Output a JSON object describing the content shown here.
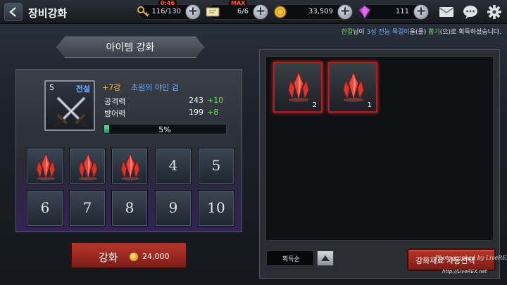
{
  "header": {
    "title": "장비강화",
    "back_icon": "back-arrow-icon"
  },
  "resources": {
    "key": {
      "icon": "key-icon",
      "value": "116/130",
      "timer": "0:46"
    },
    "ticket": {
      "icon": "ticket-icon",
      "value": "6/6",
      "badge": "MAX"
    },
    "gold": {
      "icon": "gold-coin-icon",
      "value": "33,509"
    },
    "gem": {
      "icon": "purple-gem-icon",
      "value": "111"
    }
  },
  "top_icons": [
    "mail-icon",
    "chat-icon",
    "settings-gear-icon"
  ],
  "notice": {
    "player": "한칼",
    "part1": "님이 ",
    "item": "3성 전능 목걸이",
    "part2": "을(를) ",
    "source": "뽑기",
    "part3": "(으)로 획득하셨습니다."
  },
  "enhance_panel": {
    "title": "아이템 강화",
    "item": {
      "slot_level": "5",
      "grade": "전설",
      "icon": "crossed-swords-icon",
      "enhance_level": "+7강",
      "name": "초원의 야인 검"
    },
    "stats": [
      {
        "label": "공격력",
        "value": "243",
        "bonus": "+10"
      },
      {
        "label": "방어력",
        "value": "199",
        "bonus": "+8"
      }
    ],
    "progress": {
      "percent": 5,
      "label": "5%"
    },
    "slots": [
      {
        "type": "crystal",
        "label": ""
      },
      {
        "type": "crystal",
        "label": ""
      },
      {
        "type": "crystal",
        "label": ""
      },
      {
        "type": "empty",
        "label": "4"
      },
      {
        "type": "empty",
        "label": "5"
      },
      {
        "type": "empty",
        "label": "6"
      },
      {
        "type": "empty",
        "label": "7"
      },
      {
        "type": "empty",
        "label": "8"
      },
      {
        "type": "empty",
        "label": "9"
      },
      {
        "type": "empty",
        "label": "10"
      }
    ],
    "enhance_button": {
      "label": "강화",
      "cost": "24,000",
      "cost_icon": "gold-coin-icon"
    }
  },
  "materials_panel": {
    "items": [
      {
        "icon": "red-crystal-icon",
        "count": "2"
      },
      {
        "icon": "red-crystal-icon",
        "count": "1"
      }
    ],
    "sort_label": "획득순",
    "sort_icon": "triangle-up-icon",
    "auto_select_label": "강화재료 자동선택"
  },
  "watermark": {
    "main": "Photographed by LiveREX",
    "url": "http://LiveREX.net"
  },
  "colors": {
    "accent_red": "#b9352b",
    "grade_blue": "#6fb1ff",
    "bonus_green": "#6fe05a",
    "enhance_orange": "#ffb347",
    "progress_green": "#2aa56e"
  }
}
